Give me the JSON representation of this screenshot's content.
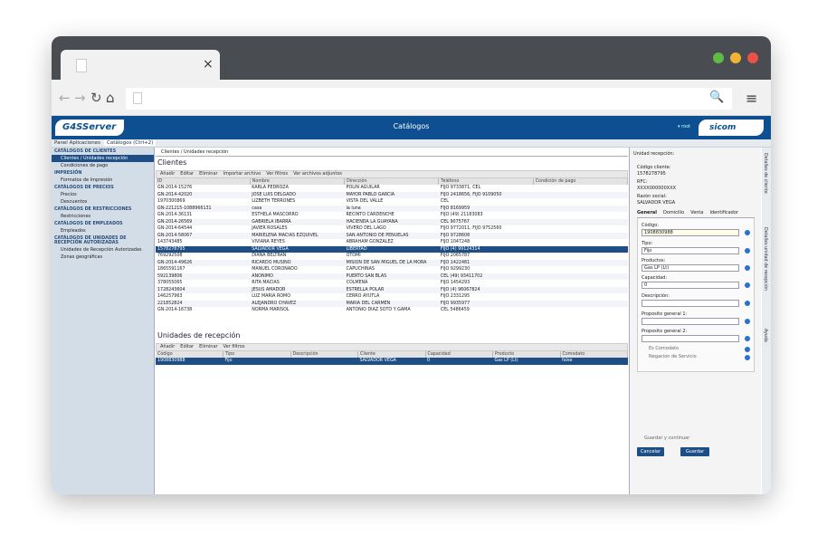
{
  "browser": {
    "tab_close": "×"
  },
  "app": {
    "logo": "G4SServer",
    "title": "Catálogos",
    "user": "▾ root",
    "brand_logo": "sicom",
    "tabs": [
      "Panel Aplicaciones",
      "Catálogos (Ctrl+2)"
    ]
  },
  "sidebar": {
    "sections": [
      {
        "title": "CATÁLOGOS DE CLIENTES",
        "items": [
          "Clientes / Unidades recepción",
          "Condiciones de pago"
        ]
      },
      {
        "title": "IMPRESIÓN",
        "items": [
          "Formatos de Impresión"
        ]
      },
      {
        "title": "CATÁLOGOS DE PRECIOS",
        "items": [
          "Precios",
          "Descuentos"
        ]
      },
      {
        "title": "CATÁLOGOS DE RESTRICCIONES",
        "items": [
          "Restricciones"
        ]
      },
      {
        "title": "CATÁLOGOS DE EMPLEADOS",
        "items": [
          "Empleados"
        ]
      },
      {
        "title": "CATÁLOGOS DE UNIDADES DE RECEPCIÓN AUTORIZADAS",
        "items": [
          "Unidades de Recepción Autorizadas",
          "Zonas geográficas"
        ]
      }
    ]
  },
  "main": {
    "subtab": "Clientes / Unidades recepción",
    "clients_title": "Clientes",
    "clients_toolbar": [
      "Añadir",
      "Editar",
      "Eliminar",
      "Importar archivo",
      "Ver filtros",
      "Ver archivos adjuntos"
    ],
    "clients_cols": [
      "ID",
      "Nombre",
      "Dirección",
      "Teléfono",
      "Condición de pago"
    ],
    "clients_rows": [
      [
        "GN-2014-15276",
        "KARLA PEDROZA",
        "POLIN AGUILAR",
        "FIJO 9733871, CEL",
        ""
      ],
      [
        "GN-2014-42020",
        "JOSE LUIS DELGADO",
        "MAYOR PABLO GARCIA",
        "FIJO 2418656, FIJO 9109050",
        ""
      ],
      [
        "1970300869",
        "LIZBETH TERRONES",
        "VISTA DEL VALLE",
        "CEL",
        ""
      ],
      [
        "GN-221215-1088966131",
        "casa",
        "la luna",
        "FIJO 8169959",
        ""
      ],
      [
        "GN-2014-36131",
        "ESTHELA MASCORRO",
        "RECINTO CARDENCHE",
        "FIJO (49) 21183083",
        ""
      ],
      [
        "GN-2014-26569",
        "GABRIELA IBARRA",
        "HACIENDA LA GUAYANA",
        "CEL 9075767",
        ""
      ],
      [
        "GN-2014-64544",
        "JAVIER ROSALES",
        "VIVERO DEL LAGO",
        "FIJO 9772011, FIJO 9752560",
        ""
      ],
      [
        "GN-2014-58067",
        "MARIELENA MACIAS EZQUIVEL",
        "SAN ANTONIO DE PEÑUELAS",
        "FIJO 9728608",
        ""
      ],
      [
        "143743485",
        "VIVIANA REYES",
        "ABRAHAM GONZALEZ",
        "FIJO 1047248",
        ""
      ],
      [
        "1578278795",
        "SALVADOR VEGA",
        "LIBERTAD",
        "FIJO (4) 99124314",
        ""
      ],
      [
        "769292508",
        "DIANA BELTRAN",
        "OTOMI",
        "FIJO 2065787",
        ""
      ],
      [
        "GN-2014-49626",
        "RICARDO MUSIÑO",
        "MISION DE SAN MIGUEL DE LA MORA",
        "FIJO 1422481",
        ""
      ],
      [
        "1865591167",
        "MANUEL CORONADO",
        "CAPUCHINAS",
        "FIJO 9299230",
        ""
      ],
      [
        "592139806",
        "ANONIMO",
        "PUERTO SAN BLAS",
        "CEL (49) 93411702",
        ""
      ],
      [
        "378055065",
        "RITA MACIAS",
        "COLMENA",
        "FIJO 1454293",
        ""
      ],
      [
        "1728243604",
        "JESUS AMADOR",
        "ESTRELLA POLAR",
        "FIJO (4) 96067824",
        ""
      ],
      [
        "146257963",
        "LUZ MARIA ROMO",
        "CERRO AYUTLA",
        "FIJO 2331295",
        ""
      ],
      [
        "221852824",
        "ALEJANDRO CHAVEZ",
        "MARIA DEL CARMEN",
        "FIJO 9935977",
        ""
      ],
      [
        "GN-2014-16738",
        "NORMA MARISOL",
        "ANTONIO DIAZ SOTO Y GAMA",
        "CEL 5486459",
        ""
      ]
    ],
    "units_title": "Unidades de recepción",
    "units_toolbar": [
      "Añadir",
      "Editar",
      "Eliminar",
      "Ver filtros"
    ],
    "units_cols": [
      "Código",
      "Tipo",
      "Descripción",
      "Cliente",
      "Capacidad",
      "Producto",
      "Comodato"
    ],
    "units_rows": [
      [
        "1908830988",
        "Fijo",
        "",
        "SALVADOR VEGA",
        "0",
        "Gas LP (Lt)",
        "false"
      ]
    ]
  },
  "panel": {
    "title": "Unidad recepción:",
    "codigo_cliente_label": "Código cliente:",
    "codigo_cliente": "1578278795",
    "rfc_label": "RFC:",
    "rfc": "XXXX000000XXX",
    "razon_label": "Razón social:",
    "razon": "SALVADOR VEGA",
    "tabs": [
      "General",
      "Domicilio",
      "Venta",
      "Identificador"
    ],
    "codigo_label": "Código:",
    "codigo": "1908830988",
    "tipo_label": "Tipo:",
    "tipo": "Fijo",
    "productos_label": "Productos:",
    "productos": "Gas LP (Lt)",
    "capacidad_label": "Capacidad:",
    "capacidad": "0",
    "descripcion_label": "Descripción:",
    "pg1_label": "Proposito general 1:",
    "pg2_label": "Proposito general 2:",
    "comodato_label": "Es Comodato",
    "negacion_label": "Negacion de Servicio",
    "guardar_continuar": "Guardar y continuar",
    "cancel": "Cancelar",
    "save": "Guardar"
  },
  "vtabs": [
    "Detalles de cliente",
    "Detalles unidad de recepción",
    "Ayuda"
  ]
}
